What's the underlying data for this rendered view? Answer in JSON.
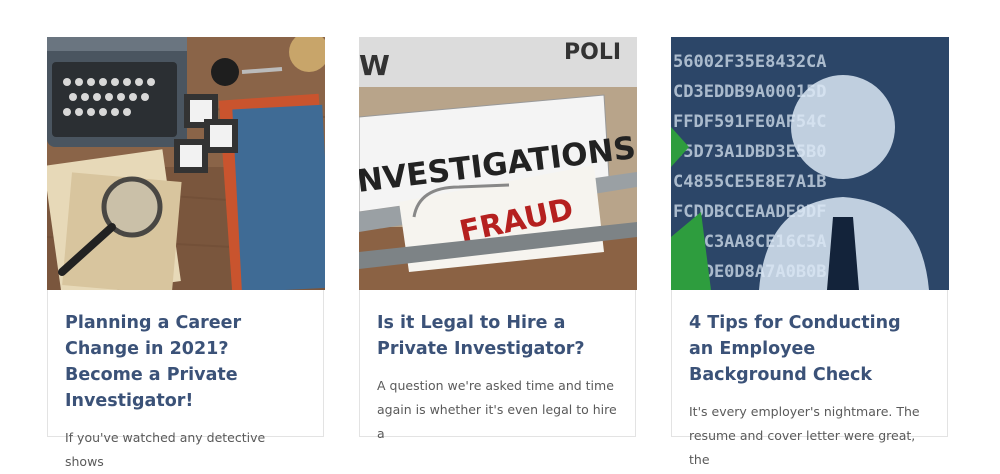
{
  "posts": [
    {
      "title": "Planning a Career Change in 2021? Become a Private Investigator!",
      "excerpt": "If you've watched any detective shows",
      "image": "detective-desk-photo"
    },
    {
      "title": "Is it Legal to Hire a Private Investigator?",
      "excerpt": "A question we're asked time and time again is whether it's even legal to hire a",
      "image": "investigations-fraud-folder-photo",
      "image_texts": [
        "W",
        "POLI",
        "NVESTIGATIONS",
        "FRAUD"
      ]
    },
    {
      "title": "4 Tips for Conducting an Employee Background Check",
      "excerpt": "It's every employer's nightmare. The resume and cover letter were great, the",
      "image": "data-silhouette-photo",
      "image_texts": [
        "56002F35E8432CA",
        "CD3EDDB9A00015D",
        "FFDF591FE0AF54C",
        "35D73A1DBD3E5B0",
        "C4855CE5E8E7A1B",
        "FCDDBCCEAADE9DF",
        "988C3AA8CE16C5A",
        "6FADE0D8A7A0B0B"
      ]
    }
  ],
  "colors": {
    "title": "#3b5278",
    "excerpt": "#5a5a5a",
    "border": "#e3e3e3"
  }
}
